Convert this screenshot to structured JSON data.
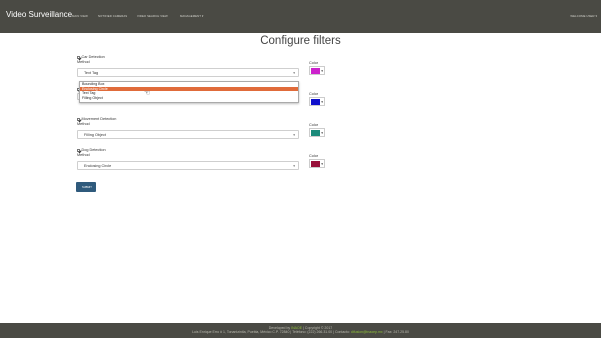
{
  "navbar": {
    "brand": "Video Surveillance",
    "links": [
      "MAIN VIEW",
      "NOTIFIED CAMERAS",
      "VIDEO SEARCH VIEW",
      "MANAGEMENT ▾"
    ],
    "user_menu": "WELCOME USER ▾"
  },
  "page": {
    "title": "Configure filters"
  },
  "method_options": [
    "Bounding Box",
    "Enclosing Circle",
    "Text Tag",
    "Filling Object"
  ],
  "filters": [
    {
      "name": "Car Detection",
      "checked": true,
      "method_label": "Method",
      "method": "Text Tag",
      "color_label": "Color",
      "color": "#cc22cc"
    },
    {
      "name": "",
      "checked": true,
      "method_label": "",
      "method": "Text Tag",
      "color_label": "Color",
      "color": "#1010cc"
    },
    {
      "name": "Movement Detection",
      "checked": true,
      "method_label": "Method",
      "method": "Filling Object",
      "color_label": "Color",
      "color": "#1a8a7a"
    },
    {
      "name": "Dog Detection",
      "checked": true,
      "method_label": "Method",
      "method": "Enclosing Circle",
      "color_label": "Color",
      "color": "#99103a"
    }
  ],
  "dropdown": {
    "highlighted": "Enclosing Circle"
  },
  "submit_label": "SUBMIT",
  "footer": {
    "line1_prefix": "Developed by ",
    "line1_link": "INAOE",
    "line1_suffix": " | Copyright © 2017",
    "line2_prefix": "Luis Enrique Erro # 1, Tonantzintla, Puebla, México C.P. 72840 | Teléfono: (222) 266.31.00 | Contacto: ",
    "line2_link": "difusion@inaoep.mx",
    "line2_suffix": " | Fax: 247.25.80"
  }
}
